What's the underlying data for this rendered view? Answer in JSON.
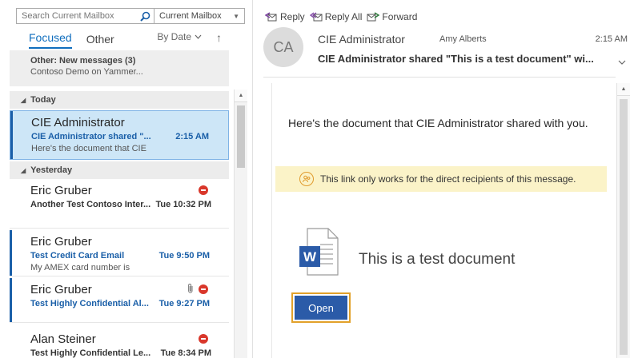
{
  "search": {
    "placeholder": "Search Current Mailbox",
    "scope": "Current Mailbox"
  },
  "tabs": {
    "focused": "Focused",
    "other": "Other",
    "sort": "By Date"
  },
  "other_banner": {
    "title": "Other: New messages (3)",
    "subtitle": "Contoso Demo on Yammer..."
  },
  "groups": {
    "today": "Today",
    "yesterday": "Yesterday"
  },
  "mails": [
    {
      "sender": "CIE Administrator",
      "subject": "CIE Administrator shared \"...",
      "time": "2:15 AM",
      "preview": "Here's the document that CIE"
    },
    {
      "sender": "Eric Gruber",
      "subject": "Another Test Contoso Inter...",
      "time": "Tue 10:32 PM",
      "preview": ""
    },
    {
      "sender": "Eric Gruber",
      "subject": "Test Credit Card Email",
      "time": "Tue 9:50 PM",
      "preview": "My AMEX card number is"
    },
    {
      "sender": "Eric Gruber",
      "subject": "Test Highly Confidential Al...",
      "time": "Tue 9:27 PM",
      "preview": ""
    },
    {
      "sender": "Alan Steiner",
      "subject": "Test Highly Confidential Le...",
      "time": "Tue 8:34 PM",
      "preview": ""
    }
  ],
  "actions": {
    "reply": "Reply",
    "reply_all": "Reply All",
    "forward": "Forward"
  },
  "header": {
    "avatar": "CA",
    "from": "CIE Administrator",
    "to": "Amy Alberts",
    "time": "2:15 AM",
    "subject": "CIE Administrator shared \"This is a test document\" wi..."
  },
  "body": {
    "text": "Here's the document that CIE Administrator shared with you.",
    "notice": "This link only works for the direct recipients of this message.",
    "doc_title": "This is a test document",
    "open": "Open"
  },
  "colors": {
    "accent": "#106ebe",
    "unread": "#1a5fa8",
    "selected_bg": "#cde6f7",
    "notice_bg": "#fbf3c8",
    "open_btn": "#2b5ba8",
    "open_border": "#e2a12a",
    "flag": "#d9372b"
  }
}
